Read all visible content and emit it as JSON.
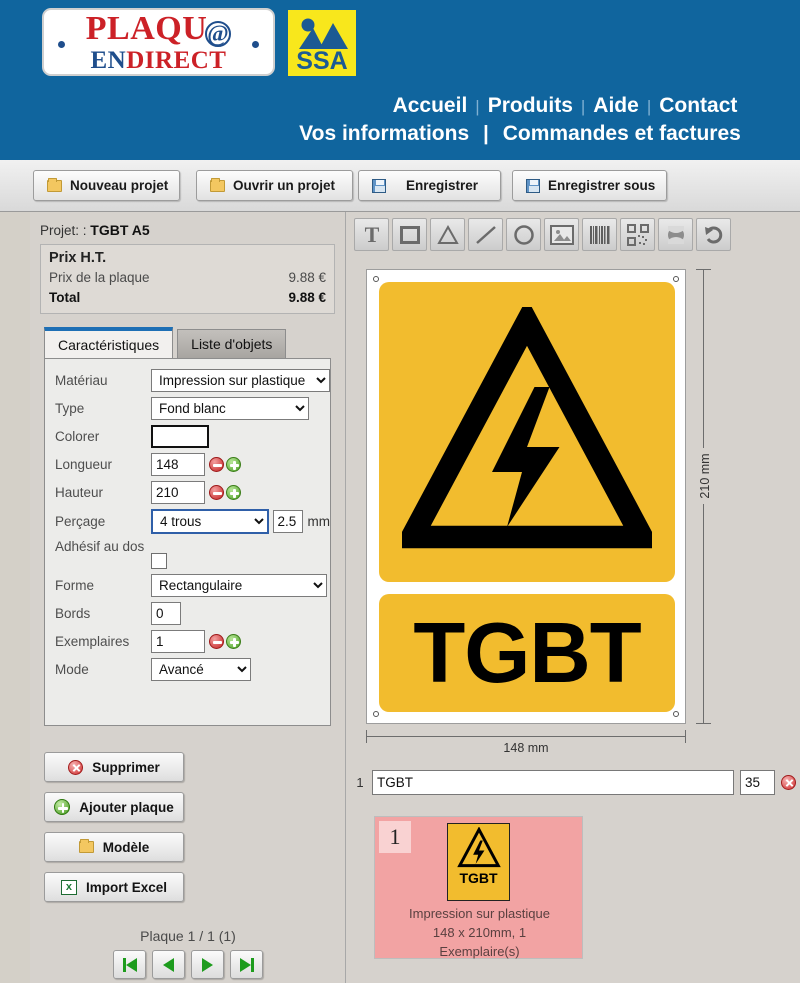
{
  "brand": {
    "logo_line1": "PLAQU",
    "logo_at": "@",
    "logo_en": "EN",
    "logo_direct": "DIRECT",
    "ssa_label": "SSA",
    "header_color": "#10659e",
    "accent_yellow": "#f2bc2e"
  },
  "nav": {
    "row1": [
      {
        "label": "Accueil"
      },
      {
        "label": "Produits"
      },
      {
        "label": "Aide"
      },
      {
        "label": "Contact"
      }
    ],
    "row2": [
      {
        "label": "Vos informations"
      },
      {
        "label": "Commandes et factures"
      }
    ],
    "separator": "|"
  },
  "toolbar": {
    "new_project": "Nouveau projet",
    "open_project": "Ouvrir un projet",
    "save": "Enregistrer",
    "save_as": "Enregistrer sous"
  },
  "sidebar": {
    "project_label": "Projet: :",
    "project_name": "TGBT A5",
    "price": {
      "title": "Prix H.T.",
      "plate_label": "Prix de la plaque",
      "plate_value": "9.88 €",
      "total_label": "Total",
      "total_value": "9.88 €"
    },
    "tabs": [
      {
        "label": "Caractéristiques",
        "active": true
      },
      {
        "label": "Liste d'objets",
        "active": false
      }
    ],
    "fields": {
      "material_label": "Matériau",
      "material_value": "Impression sur plastique",
      "type_label": "Type",
      "type_value": "Fond blanc",
      "color_label": "Colorer",
      "color_value": "#ffffff",
      "length_label": "Longueur",
      "length_value": "148",
      "height_label": "Hauteur",
      "height_value": "210",
      "drilling_label": "Perçage",
      "drilling_value": "4 trous",
      "drilling_size": "2.5",
      "drilling_unit": "mm",
      "adhesive_label": "Adhésif au dos",
      "adhesive_checked": false,
      "shape_label": "Forme",
      "shape_value": "Rectangulaire",
      "borders_label": "Bords",
      "borders_value": "0",
      "copies_label": "Exemplaires",
      "copies_value": "1",
      "mode_label": "Mode",
      "mode_value": "Avancé"
    },
    "actions": {
      "delete": "Supprimer",
      "add_plate": "Ajouter plaque",
      "template": "Modèle",
      "import_excel": "Import Excel"
    },
    "pager": {
      "label": "Plaque 1 / 1 (1)",
      "first": "first-page",
      "prev": "previous-page",
      "next": "next-page",
      "last": "last-page"
    }
  },
  "editor": {
    "object_tools": [
      {
        "name": "text-tool",
        "glyph": "T"
      },
      {
        "name": "rectangle-tool",
        "glyph": "rect"
      },
      {
        "name": "triangle-tool",
        "glyph": "triangle"
      },
      {
        "name": "line-tool",
        "glyph": "line"
      },
      {
        "name": "circle-tool",
        "glyph": "circle"
      },
      {
        "name": "image-tool",
        "glyph": "image"
      },
      {
        "name": "barcode-tool",
        "glyph": "barcode"
      },
      {
        "name": "qrcode-tool",
        "glyph": "qrcode"
      },
      {
        "name": "pictogram-tool",
        "glyph": "pictogram"
      },
      {
        "name": "undo-tool",
        "glyph": "undo"
      }
    ],
    "canvas": {
      "sign_text": "TGBT",
      "sign_symbol": "electrical-hazard",
      "width_dimension": "148 mm",
      "height_dimension": "210 mm",
      "plate_color": "#f2bc2e"
    },
    "text_row": {
      "index": "1",
      "value": "TGBT",
      "font_size": "35"
    },
    "thumbnail": {
      "number": "1",
      "sign_text": "TGBT",
      "line1": "Impression sur plastique",
      "line2": "148 x 210mm, 1",
      "line3": "Exemplaire(s)"
    }
  }
}
